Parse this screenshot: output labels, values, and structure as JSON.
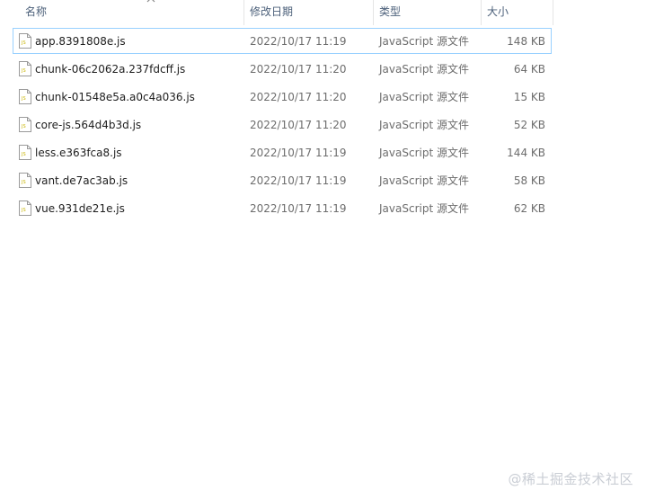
{
  "header": {
    "columns": {
      "name": "名称",
      "date": "修改日期",
      "type": "类型",
      "size": "大小"
    }
  },
  "files": [
    {
      "name": "app.8391808e.js",
      "date": "2022/10/17 11:19",
      "type": "JavaScript 源文件",
      "size": "148 KB"
    },
    {
      "name": "chunk-06c2062a.237fdcff.js",
      "date": "2022/10/17 11:20",
      "type": "JavaScript 源文件",
      "size": "64 KB"
    },
    {
      "name": "chunk-01548e5a.a0c4a036.js",
      "date": "2022/10/17 11:20",
      "type": "JavaScript 源文件",
      "size": "15 KB"
    },
    {
      "name": "core-js.564d4b3d.js",
      "date": "2022/10/17 11:20",
      "type": "JavaScript 源文件",
      "size": "52 KB"
    },
    {
      "name": "less.e363fca8.js",
      "date": "2022/10/17 11:19",
      "type": "JavaScript 源文件",
      "size": "144 KB"
    },
    {
      "name": "vant.de7ac3ab.js",
      "date": "2022/10/17 11:19",
      "type": "JavaScript 源文件",
      "size": "58 KB"
    },
    {
      "name": "vue.931de21e.js",
      "date": "2022/10/17 11:19",
      "type": "JavaScript 源文件",
      "size": "62 KB"
    }
  ],
  "icons": {
    "file": "js-file-icon",
    "sort": "sort-up-icon"
  },
  "colors": {
    "selection_border": "#99d1ff",
    "header_text": "#4c607a",
    "secondary_text": "#6d6d6d"
  },
  "watermark": "@稀土掘金技术社区"
}
